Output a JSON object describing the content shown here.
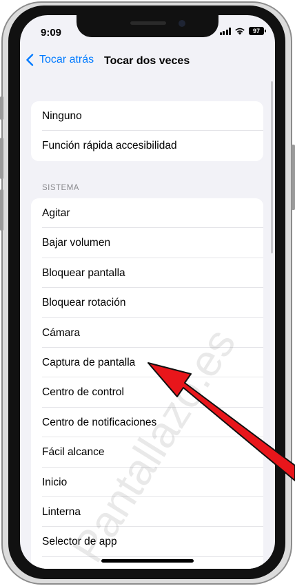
{
  "status_bar": {
    "time": "9:09",
    "battery": "97"
  },
  "nav": {
    "back_label": "Tocar atrás",
    "title": "Tocar dos veces"
  },
  "top_group": {
    "items": [
      "Ninguno",
      "Función rápida accesibilidad"
    ]
  },
  "system_section": {
    "header": "SISTEMA",
    "items": [
      "Agitar",
      "Bajar volumen",
      "Bloquear pantalla",
      "Bloquear rotación",
      "Cámara",
      "Captura de pantalla",
      "Centro de control",
      "Centro de notificaciones",
      "Fácil alcance",
      "Inicio",
      "Linterna",
      "Selector de app"
    ]
  },
  "watermark": "Pantallazo.es",
  "colors": {
    "accent": "#007aff",
    "background": "#f2f2f7",
    "arrow": "#e8161b"
  }
}
